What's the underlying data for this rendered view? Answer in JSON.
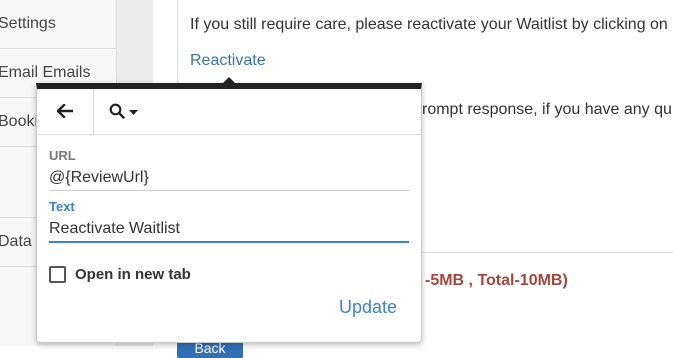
{
  "sidebar": {
    "items": [
      {
        "label": "Settings"
      },
      {
        "label": "Email Emails"
      },
      {
        "label": "Booking"
      },
      {
        "label": ""
      },
      {
        "label": "Data"
      }
    ]
  },
  "editor": {
    "line1": "If you still require care, please reactivate your Waitlist by clicking on",
    "link_text": "Reactivate",
    "line2": "rompt response, if you have any qu"
  },
  "attachment_note": "-5MB , Total-10MB)",
  "bottom_button": "Back",
  "link_popup": {
    "back_icon": "arrow-left-icon",
    "search_icon": "search-icon",
    "url_label": "URL",
    "url_value": "@{ReviewUrl}",
    "text_label": "Text",
    "text_value": "Reactivate Waitlist",
    "checkbox_label": "Open in new tab",
    "checkbox_checked": false,
    "update_label": "Update"
  },
  "colors": {
    "accent": "#3a82d6",
    "link": "#3a73b7",
    "warning_text": "#a9443d",
    "popup_top_border": "#222222"
  }
}
